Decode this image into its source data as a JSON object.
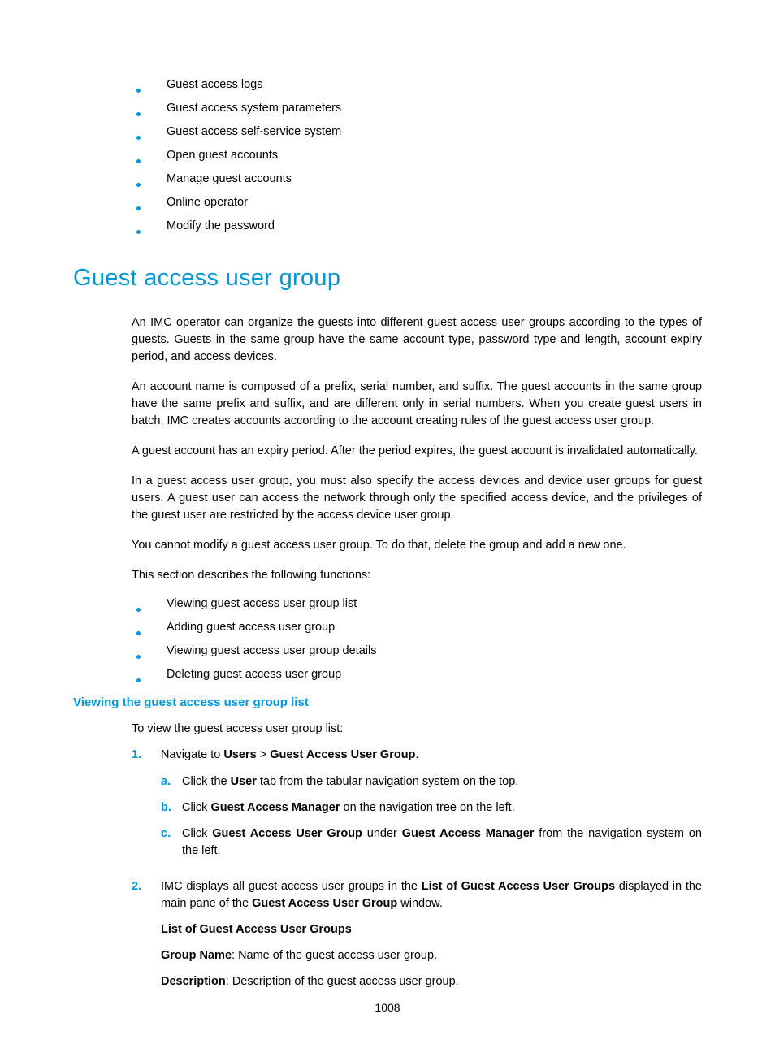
{
  "topBullets": [
    "Guest access logs",
    "Guest access system parameters",
    "Guest access self-service system",
    "Open guest accounts",
    "Manage guest accounts",
    "Online operator",
    "Modify the password"
  ],
  "sectionHeading": "Guest access user group",
  "paragraphs": {
    "p1": "An IMC operator can organize the guests into different guest access user groups according to the types of guests. Guests in the same group have the same account type, password type and length, account expiry period, and access devices.",
    "p2": "An account name is composed of a prefix, serial number, and suffix. The guest accounts in the same group have the same prefix and suffix, and are different only in serial numbers. When you create guest users in batch, IMC creates accounts according to the account creating rules of the guest access user group.",
    "p3": "A guest account has an expiry period. After the period expires, the guest account is invalidated automatically.",
    "p4": "In a guest access user group, you must also specify the access devices and device user groups for guest users. A guest user can access the network through only the specified access device, and the privileges of the guest user are restricted by the access device user group.",
    "p5": "You cannot modify a guest access user group. To do that, delete the group and add a new one.",
    "p6": "This section describes the following functions:"
  },
  "funcBullets": [
    "Viewing guest access user group list",
    "Adding guest access user group",
    "Viewing guest access user group details",
    "Deleting guest access user group"
  ],
  "subsectionHeading": "Viewing the guest access user group list",
  "introLine": "To view the guest access user group list:",
  "ol": {
    "n1": "1.",
    "n2": "2.",
    "item1": {
      "pre": "Navigate to ",
      "b1": "Users",
      "sep": " > ",
      "b2": "Guest Access User Group",
      "post": "."
    },
    "sub": {
      "la": "a.",
      "lb": "b.",
      "lc": "c.",
      "a": {
        "pre": "Click the ",
        "b": "User",
        "post": " tab from the tabular navigation system on the top."
      },
      "b": {
        "pre": "Click ",
        "b": "Guest Access Manager",
        "post": " on the navigation tree on the left."
      },
      "c": {
        "pre": "Click ",
        "b1": "Guest Access User Group",
        "mid": " under ",
        "b2": "Guest Access Manager",
        "post": " from the navigation system on the left."
      }
    },
    "item2": {
      "pre": "IMC displays all guest access user groups in the ",
      "b1": "List of Guest Access User Groups",
      "mid": " displayed in the main pane of the ",
      "b2": "Guest Access User Group",
      "post": " window.",
      "listTitle": "List of Guest Access User Groups",
      "gn": {
        "label": "Group Name",
        "text": ": Name of the guest access user group."
      },
      "desc": {
        "label": "Description",
        "text": ": Description of the guest access user group."
      }
    }
  },
  "pageNumber": "1008"
}
